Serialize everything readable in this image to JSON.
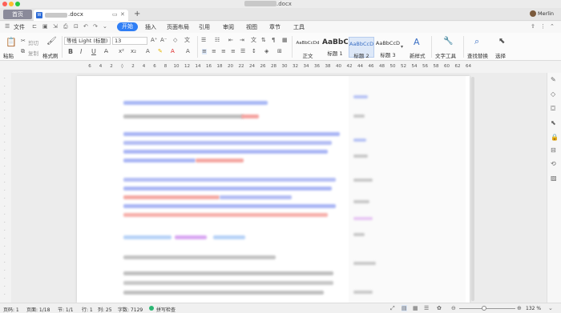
{
  "window": {
    "title_suffix": ".docx"
  },
  "tabs": {
    "home": "首页",
    "doc_name_suffix": ".docx",
    "new_tab": "+"
  },
  "user": {
    "name": "Merlin"
  },
  "menu": {
    "file": "文件",
    "items": [
      "开始",
      "插入",
      "页面布局",
      "引用",
      "审阅",
      "视图",
      "章节",
      "工具"
    ],
    "active": "开始"
  },
  "ribbon": {
    "paste": "粘贴",
    "cut": "剪切",
    "copy": "复制",
    "format_painter": "格式刷",
    "font_name": "等线 Light (标题)",
    "font_size": "13",
    "styles": [
      {
        "preview": "AaBbCcDd",
        "label": "正文"
      },
      {
        "preview": "AaBbC",
        "label": "标题 1"
      },
      {
        "preview": "AaBbCcDd",
        "label": "标题 2"
      },
      {
        "preview": "AaBbCcD",
        "label": "标题 3"
      }
    ],
    "new_style": "新样式",
    "text_tools": "文字工具",
    "find_replace": "查找替换",
    "select": "选择"
  },
  "ruler": {
    "ticks": [
      "6",
      "4",
      "2",
      "",
      "2",
      "4",
      "6",
      "8",
      "10",
      "12",
      "14",
      "16",
      "18",
      "20",
      "22",
      "24",
      "26",
      "28",
      "30",
      "32",
      "34",
      "36",
      "38",
      "40",
      "42",
      "44",
      "46",
      "48",
      "50",
      "52",
      "54",
      "56",
      "58",
      "60",
      "62",
      "64"
    ]
  },
  "status": {
    "page_num": "页码: 1",
    "pages": "页面: 1/18",
    "section": "节: 1/1",
    "row": "行: 1",
    "col": "列: 25",
    "words": "字数: 7129",
    "spell_check": "拼写检查",
    "zoom": "132 %"
  },
  "colors": {
    "accent": "#2f7ef5",
    "doc_blue": "#3a5ae8",
    "doc_red": "#e8453c"
  }
}
